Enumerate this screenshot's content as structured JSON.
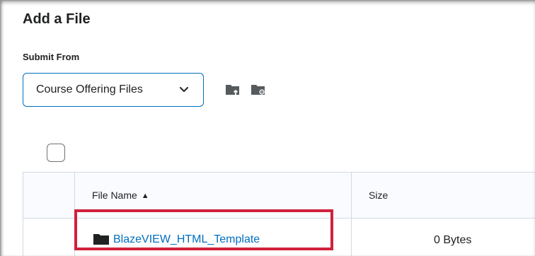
{
  "title": "Add a File",
  "submit_from": {
    "label": "Submit From",
    "selected": "Course Offering Files",
    "tools": [
      {
        "icon": "folder-upload-icon"
      },
      {
        "icon": "folder-settings-icon"
      }
    ]
  },
  "table": {
    "select_all_checked": false,
    "headers": {
      "file_name": "File Name",
      "size": "Size",
      "sort": "ascending"
    },
    "rows": [
      {
        "name": "BlazeVIEW_HTML_Template",
        "size": "0 Bytes",
        "icon": "folder-icon"
      }
    ]
  },
  "colors": {
    "accent": "#006fbf",
    "highlight": "#d0213c",
    "border": "#d3d9e3",
    "header_bg": "#f9fbff"
  }
}
